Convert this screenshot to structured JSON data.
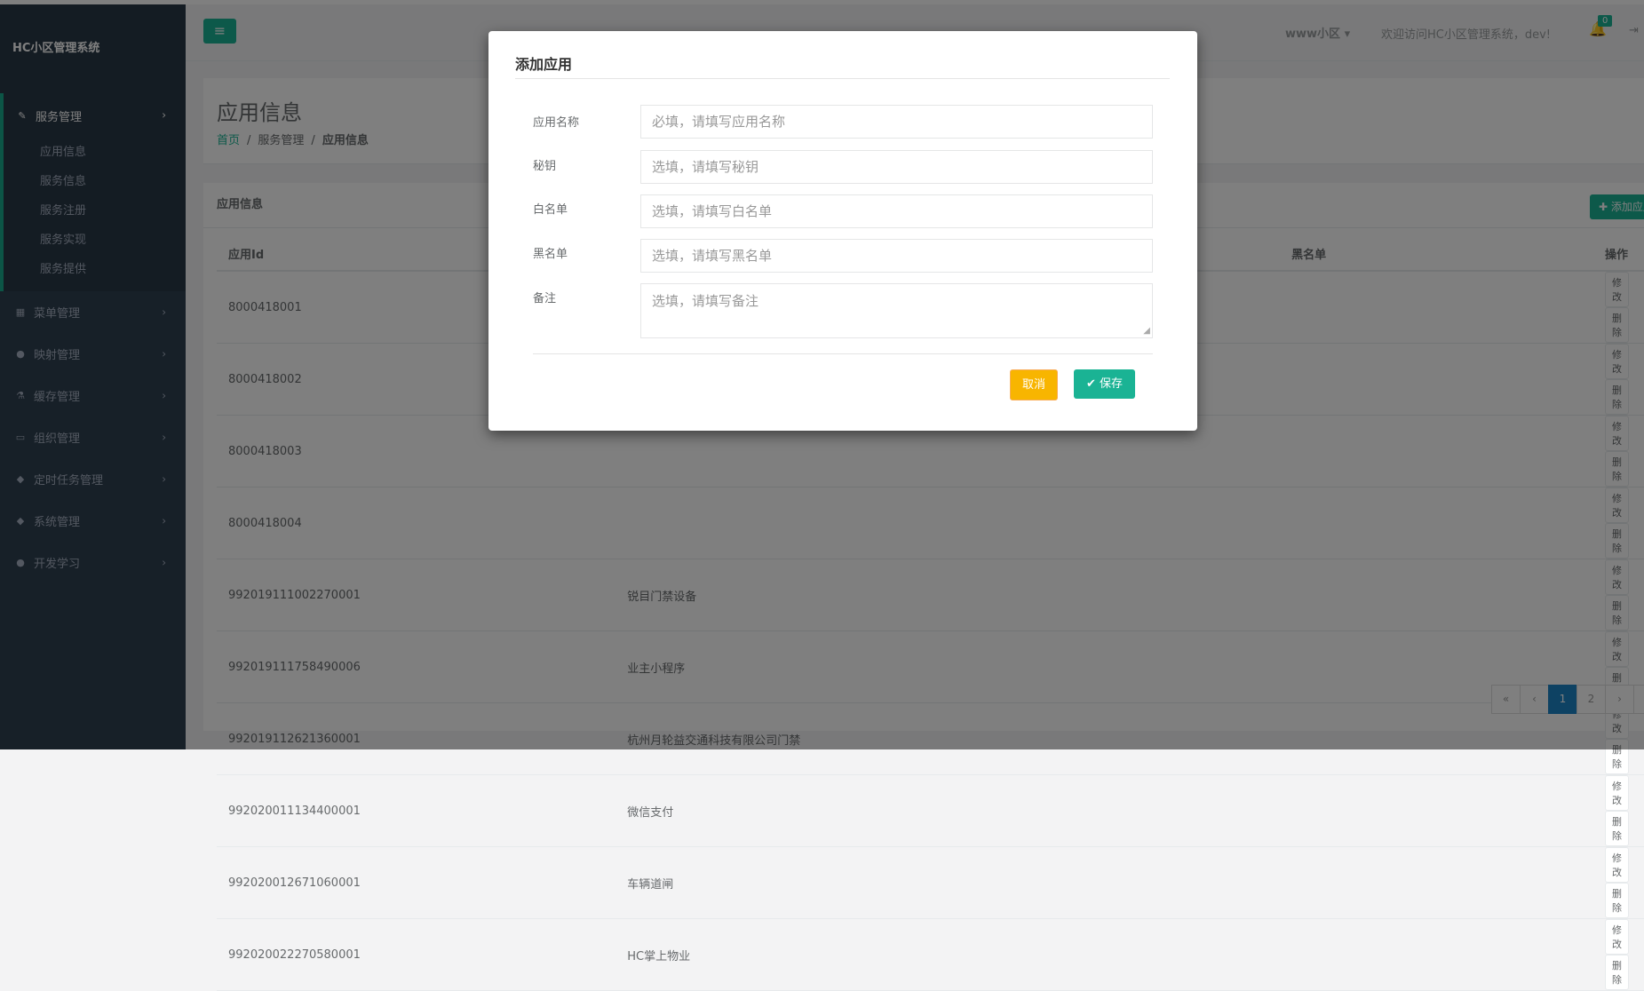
{
  "brand": "HC小区管理系统",
  "sidebar": {
    "open_group": {
      "icon": "edit-icon",
      "label": "服务管理"
    },
    "sub_items": [
      "应用信息",
      "服务信息",
      "服务注册",
      "服务实现",
      "服务提供"
    ],
    "groups": [
      {
        "icon": "grid-icon",
        "label": "菜单管理"
      },
      {
        "icon": "globe-icon",
        "label": "映射管理"
      },
      {
        "icon": "flask-icon",
        "label": "缓存管理"
      },
      {
        "icon": "desktop-icon",
        "label": "组织管理"
      },
      {
        "icon": "diamond-icon",
        "label": "定时任务管理"
      },
      {
        "icon": "diamond-icon",
        "label": "系统管理"
      },
      {
        "icon": "globe-icon",
        "label": "开发学习"
      }
    ]
  },
  "topbar": {
    "community": "www小区",
    "welcome": "欢迎访问HC小区管理系统，dev!",
    "notification_count": "0"
  },
  "page": {
    "title": "应用信息",
    "breadcrumb": {
      "home": "首页",
      "section": "服务管理",
      "current": "应用信息"
    }
  },
  "card": {
    "title": "应用信息",
    "add_button": "添加应用"
  },
  "table": {
    "columns": [
      "应用Id",
      "黑名单",
      "操作"
    ],
    "rows": [
      {
        "id": "8000418001",
        "name": ""
      },
      {
        "id": "8000418002",
        "name": ""
      },
      {
        "id": "8000418003",
        "name": ""
      },
      {
        "id": "8000418004",
        "name": ""
      },
      {
        "id": "992019111002270001",
        "name": "锐目门禁设备"
      },
      {
        "id": "992019111758490006",
        "name": "业主小程序"
      },
      {
        "id": "992019112621360001",
        "name": "杭州月轮益交通科技有限公司门禁"
      },
      {
        "id": "992020011134400001",
        "name": "微信支付"
      },
      {
        "id": "992020012671060001",
        "name": "车辆道闸"
      },
      {
        "id": "992020022270580001",
        "name": "HC掌上物业"
      }
    ],
    "edit_label": "修改",
    "delete_label": "删除"
  },
  "pagination": {
    "first": "«",
    "prev": "‹",
    "pages": [
      "1",
      "2"
    ],
    "current": "1",
    "next": "›",
    "last": "»"
  },
  "modal": {
    "title": "添加应用",
    "fields": [
      {
        "label": "应用名称",
        "placeholder": "必填，请填写应用名称"
      },
      {
        "label": "秘钥",
        "placeholder": "选填，请填写秘钥"
      },
      {
        "label": "白名单",
        "placeholder": "选填，请填写白名单"
      },
      {
        "label": "黑名单",
        "placeholder": "选填，请填写黑名单"
      },
      {
        "label": "备注",
        "placeholder": "选填，请填写备注"
      }
    ],
    "cancel": "取消",
    "save": "保存"
  },
  "colors": {
    "accent": "#1ab394",
    "sidebar": "#2f4050",
    "warning": "#f8b500",
    "primary": "#1c84c6"
  }
}
